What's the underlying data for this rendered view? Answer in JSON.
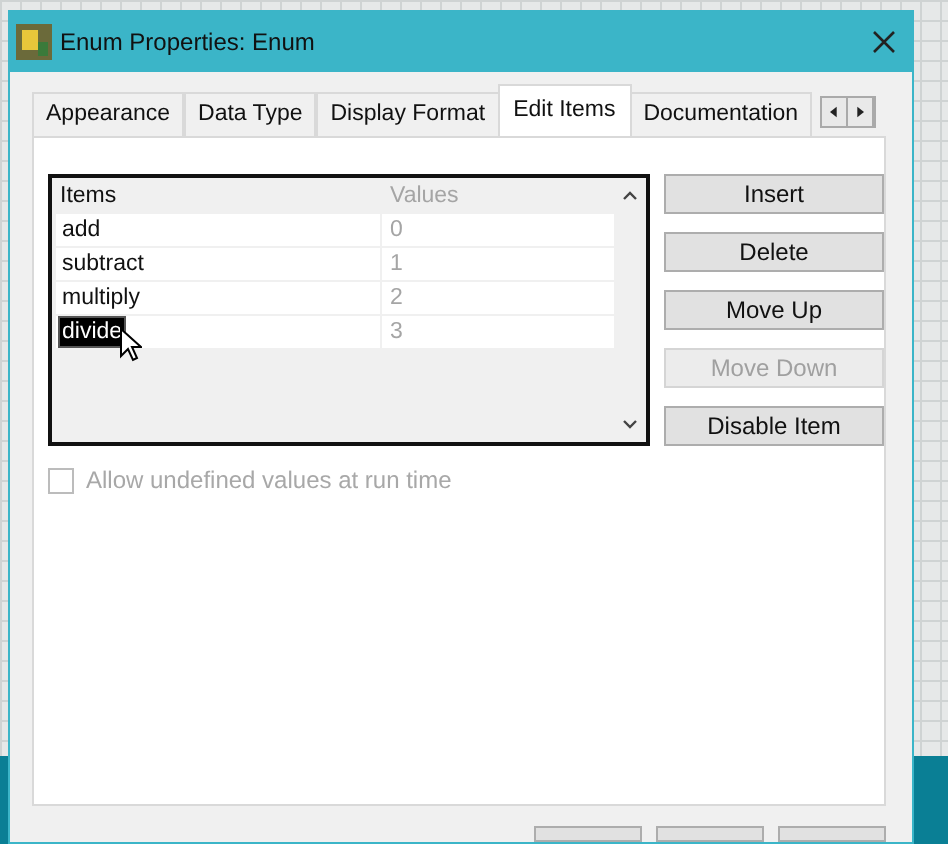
{
  "window": {
    "title": "Enum Properties: Enum"
  },
  "tabs": [
    {
      "label": "Appearance",
      "selected": false
    },
    {
      "label": "Data Type",
      "selected": false
    },
    {
      "label": "Display Format",
      "selected": false
    },
    {
      "label": "Edit Items",
      "selected": true
    },
    {
      "label": "Documentation",
      "selected": false
    }
  ],
  "table": {
    "columns": [
      "Items",
      "Values"
    ],
    "rows": [
      {
        "item": "add",
        "value": "0",
        "selected": false
      },
      {
        "item": "subtract",
        "value": "1",
        "selected": false
      },
      {
        "item": "multiply",
        "value": "2",
        "selected": false
      },
      {
        "item": "divide",
        "value": "3",
        "selected": true
      }
    ]
  },
  "buttons": [
    {
      "label": "Insert",
      "disabled": false
    },
    {
      "label": "Delete",
      "disabled": false
    },
    {
      "label": "Move Up",
      "disabled": false
    },
    {
      "label": "Move Down",
      "disabled": true
    },
    {
      "label": "Disable Item",
      "disabled": false
    }
  ],
  "allow_undefined": {
    "label": "Allow undefined values at run time",
    "checked": false,
    "disabled": true
  }
}
